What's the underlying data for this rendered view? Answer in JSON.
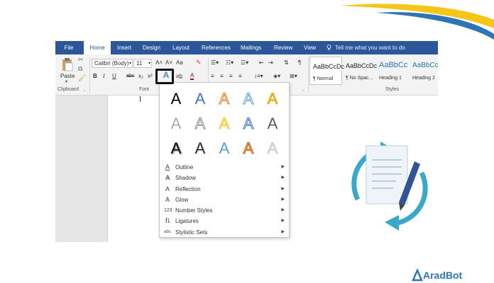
{
  "tabs": [
    {
      "label": "File"
    },
    {
      "label": "Home"
    },
    {
      "label": "Insert"
    },
    {
      "label": "Design"
    },
    {
      "label": "Layout"
    },
    {
      "label": "References"
    },
    {
      "label": "Mailings"
    },
    {
      "label": "Review"
    },
    {
      "label": "View"
    }
  ],
  "tell_me": "Tell me what you want to do",
  "clipboard": {
    "paste_label": "Paste",
    "group_label": "Clipboard"
  },
  "font": {
    "name": "Calibri (Body)",
    "size": "11",
    "group_label": "Font",
    "bold": "B",
    "italic": "I",
    "underline": "U",
    "strike": "abc",
    "sub": "x₂",
    "sup": "x²",
    "grow": "A˄",
    "shrink": "A˅",
    "case": "Aa"
  },
  "styles": {
    "group_label": "Styles",
    "items": [
      {
        "preview": "AaBbCcDc",
        "name": "¶ Normal"
      },
      {
        "preview": "AaBbCcDc",
        "name": "¶ No Spac..."
      },
      {
        "preview": "AaBbCc",
        "name": "Heading 1"
      },
      {
        "preview": "AaBbCcD",
        "name": "Heading 2"
      }
    ]
  },
  "text_effects": {
    "gallery_glyph": "A",
    "menu": [
      {
        "icon": "outline-icon",
        "label": "Outline"
      },
      {
        "icon": "shadow-icon",
        "label": "Shadow"
      },
      {
        "icon": "reflection-icon",
        "label": "Reflection"
      },
      {
        "icon": "glow-icon",
        "label": "Glow"
      },
      {
        "icon": "number-styles-icon",
        "label": "Number Styles"
      },
      {
        "icon": "ligatures-icon",
        "label": "Ligatures"
      },
      {
        "icon": "stylistic-sets-icon",
        "label": "Stylistic Sets"
      }
    ]
  },
  "brand": {
    "name": "AradBot"
  },
  "colors": {
    "word_blue": "#2b579a",
    "brand_blue": "#2e75b6",
    "swoosh_yellow": "#f5c518",
    "cycle_teal": "#3aa9c9"
  }
}
